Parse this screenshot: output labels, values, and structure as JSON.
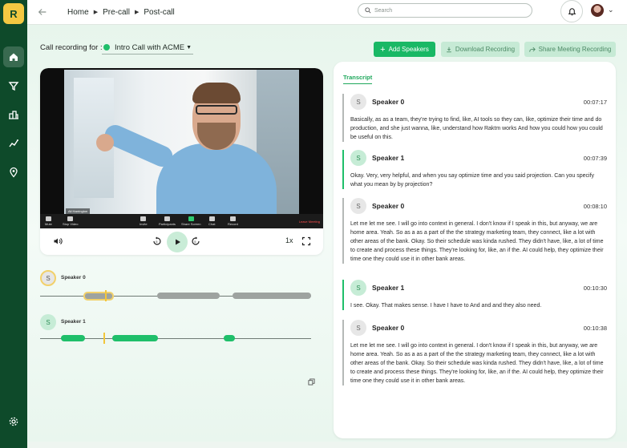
{
  "sidebar": {
    "logo_text": "R",
    "items": [
      {
        "icon": "home-icon"
      },
      {
        "icon": "filter-icon"
      },
      {
        "icon": "buildings-icon"
      },
      {
        "icon": "chart-icon"
      },
      {
        "icon": "location-icon"
      }
    ],
    "bottom_icon": "gear-icon"
  },
  "header": {
    "breadcrumbs": [
      "Home",
      "Pre-call",
      "Post-call"
    ],
    "search_placeholder": "Search"
  },
  "recording": {
    "label": "Call recording for :",
    "selected": "Intro Call with ACME"
  },
  "actions": {
    "add_speakers": "Add Speakers",
    "download": "Download Recording",
    "share": "Share Meeting Recording"
  },
  "video": {
    "name_tag": "Ali Harrington",
    "zoom_controls": [
      "Mute",
      "Stop Video",
      "Invite",
      "Participants",
      "Share Screen",
      "Chat",
      "Record"
    ],
    "leave_label": "Leave Meeting",
    "speed": "1x"
  },
  "speakers": [
    {
      "initial": "S",
      "name": "Speaker 0"
    },
    {
      "initial": "S",
      "name": "Speaker 1"
    }
  ],
  "transcript": {
    "tab": "Transcript",
    "entries": [
      {
        "initial": "S",
        "speaker": "Speaker 0",
        "time": "00:07:17",
        "text": "Basically, as as a team, they're trying to find, like, AI tools so they can, like, optimize their time and do production, and she just wanna, like, understand how Raktm works And how you could how you could be useful on this."
      },
      {
        "initial": "S",
        "speaker": "Speaker 1",
        "time": "00:07:39",
        "text": "Okay. Very, very helpful, and when you say optimize time and you said projection. Can you specify what you mean by by projection?"
      },
      {
        "initial": "S",
        "speaker": "Speaker 0",
        "time": "00:08:10",
        "text": "Let me let me see. I will go into context in general. I don't know if I speak in this, but anyway, we are home area. Yeah. So as a as a part of the the strategy marketing team, they connect, like a lot with other areas of the bank. Okay. So their schedule was kinda rushed. They didn't have, like, a lot of time to create and process these things. They're looking for, like, an if the. AI could help, they optimize their time one they could use it in other bank areas."
      },
      {
        "initial": "S",
        "speaker": "Speaker 1",
        "time": "00:10:30",
        "text": "I see. Okay. That makes sense. I have I have to And and and they also need."
      },
      {
        "initial": "S",
        "speaker": "Speaker 0",
        "time": "00:10:38",
        "text": "Let me let me see. I will go into context in general. I don't know if I speak in this, but anyway, we are home area. Yeah. So as a as a part of the the strategy marketing team, they connect, like a lot with other areas of the bank. Okay. So their schedule was kinda rushed. They didn't have, like, a lot of time to create and process these things. They're looking for, like, an if the. AI could help, they optimize their time one they could use it in other bank areas."
      }
    ]
  },
  "colors": {
    "sidebar": "#0e4a2a",
    "accent": "#1fbf6a",
    "highlight": "#f2d16b"
  }
}
